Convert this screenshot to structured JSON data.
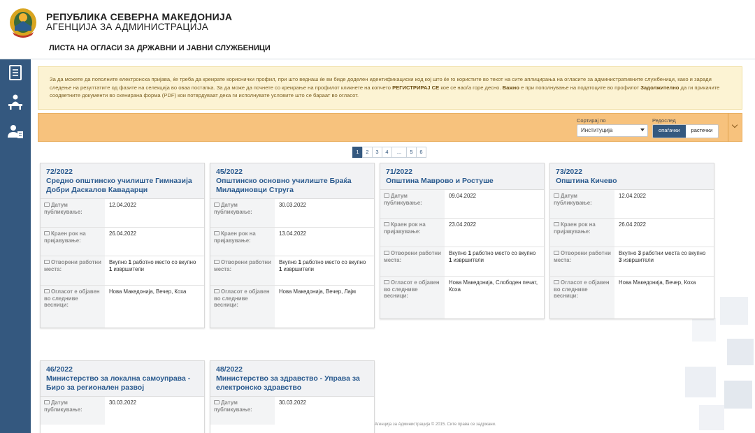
{
  "header": {
    "title": "РЕПУБЛИКА СЕВЕРНА МАКЕДОНИЈА",
    "subtitle": "АГЕНЦИЈА ЗА АДМИНИСТРАЦИЈА",
    "page_heading": "ЛИСТА НА ОГЛАСИ ЗА ДРЖАВНИ И ЈАВНИ СЛУЖБЕНИЦИ"
  },
  "sidebar": {
    "items": [
      {
        "icon": "list-document-icon"
      },
      {
        "icon": "desk-worker-icon"
      },
      {
        "icon": "user-document-icon"
      }
    ]
  },
  "notice": {
    "part1": "За да можете да пополните електронска пријава, ќе треба да креирате кориснички профил, при што веднаш ќе ви биде доделен идентификациски код кој што ќе го користите во текот на сите аплицирања на огласите за административните службеници, како и заради следење на резултатите од фазите на селекција во оваа постапка. За да може да почнете со креирање на профилот кликнете на копчето ",
    "bold1": "РЕГИСТРИРАЈ СЕ",
    "part2": " кое се наоѓа горе десно. ",
    "bold2": "Важно",
    "part3": " е при пополнување на податоците во профилот ",
    "bold3": "Задолжително",
    "part4": " да ги прикачите соодветните документи во скенирана форма (PDF) кои потврдуваат дека ги исполнувате условите што се бараат во огласот."
  },
  "sort": {
    "label": "Сортирај по",
    "selected": "Институција",
    "order_label": "Редослед",
    "descending": "опаѓачки",
    "ascending": "растечки"
  },
  "pagination": {
    "pages": [
      "1",
      "2",
      "3",
      "4",
      "...",
      "5",
      "6"
    ],
    "active": "1"
  },
  "labels": {
    "published": "Датум публикување:",
    "deadline": "Краен рок на пријавување:",
    "positions": "Отворени работни места:",
    "newspapers": "Огласот е објавен во следниве весници:"
  },
  "cards": [
    {
      "number": "72/2022",
      "institution": "Средно општинско училиште Гимназија Добри Даскалов Кавадарци",
      "published": "12.04.2022",
      "deadline": "26.04.2022",
      "pos_pre": "Вкупно ",
      "pos_count": "1",
      "pos_mid": " работно место со вкупно ",
      "pos_execs": "1",
      "pos_post": " извршители",
      "newspapers": "Нова Македонија, Вечер, Коха"
    },
    {
      "number": "45/2022",
      "institution": "Општинско основно училиште Браќа Миладиновци Струга",
      "published": "30.03.2022",
      "deadline": "13.04.2022",
      "pos_pre": "Вкупно ",
      "pos_count": "1",
      "pos_mid": " работно место со вкупно ",
      "pos_execs": "1",
      "pos_post": " извршители",
      "newspapers": "Нова Македонија, Вечер, Лајм"
    },
    {
      "number": "71/2022",
      "institution": "Општина Маврово и Ростуше",
      "published": "09.04.2022",
      "deadline": "23.04.2022",
      "pos_pre": "Вкупно ",
      "pos_count": "1",
      "pos_mid": " работно место со вкупно ",
      "pos_execs": "1",
      "pos_post": " извршители",
      "newspapers": "Нова Македонија, Слободен печат, Коха"
    },
    {
      "number": "73/2022",
      "institution": "Општина Кичево",
      "published": "12.04.2022",
      "deadline": "26.04.2022",
      "pos_pre": "Вкупно ",
      "pos_count": "3",
      "pos_mid": " работни места со вкупно ",
      "pos_execs": "3",
      "pos_post": " извршители",
      "newspapers": "Нова Македонија, Вечер, Коха"
    },
    {
      "number": "46/2022",
      "institution": "Министерство за локална самоуправа - Биро за регионален развој",
      "published": "30.03.2022"
    },
    {
      "number": "48/2022",
      "institution": "Министерство за здравство - Управа за електронско здравство",
      "published": "30.03.2022"
    }
  ],
  "footer": "Агенција за Администрација © 2015. Сите права се задржани."
}
